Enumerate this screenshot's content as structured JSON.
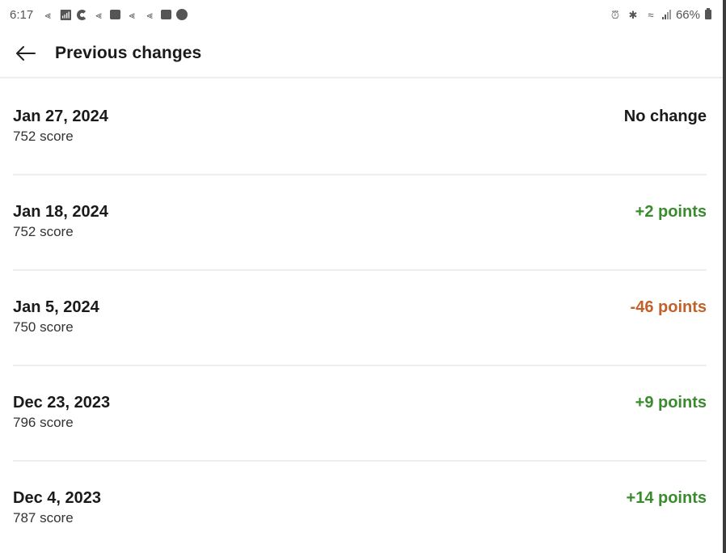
{
  "status_bar": {
    "time": "6:17",
    "left_icons": [
      "notification-icon",
      "wifi-calling-icon",
      "app-c-icon",
      "notification-icon",
      "mail-icon",
      "notification-icon",
      "notification-icon",
      "gallery-icon",
      "app-badge-icon"
    ],
    "right_icons": [
      "alarm-icon",
      "bluetooth-icon",
      "wifi-icon",
      "signal-icon"
    ],
    "battery": "66%"
  },
  "header": {
    "back_icon": "arrow-left-icon",
    "title": "Previous changes"
  },
  "colors": {
    "positive": "#3a8a2e",
    "negative": "#c0622a",
    "neutral": "#1a1a1a"
  },
  "changes": [
    {
      "date": "Jan 27, 2024",
      "score": "752 score",
      "change": "No change",
      "type": "neutral"
    },
    {
      "date": "Jan 18, 2024",
      "score": "752 score",
      "change": "+2 points",
      "type": "positive"
    },
    {
      "date": "Jan 5, 2024",
      "score": "750 score",
      "change": "-46 points",
      "type": "negative"
    },
    {
      "date": "Dec 23, 2023",
      "score": "796 score",
      "change": "+9 points",
      "type": "positive"
    },
    {
      "date": "Dec 4, 2023",
      "score": "787 score",
      "change": "+14 points",
      "type": "positive"
    }
  ]
}
